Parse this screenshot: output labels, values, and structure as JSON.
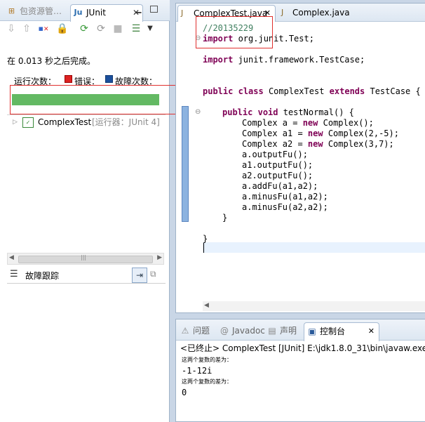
{
  "left_panel": {
    "tabs": [
      {
        "label": "包资源管…",
        "icon": "package-explorer-icon"
      },
      {
        "label": "JUnit",
        "icon": "junit-icon"
      }
    ],
    "status_text": "在 0.013 秒之后完成。",
    "runs_label": "运行次数：",
    "errors_label": "错误：",
    "failures_label": "故障次数：",
    "progress": 1.0,
    "progress_color": "#63b963",
    "tree_item": "ComplexTest",
    "tree_runner": "[运行器：JUnit 4]",
    "failure_trace_label": "故障跟踪",
    "scroll_left": "◀",
    "scroll_mid": "|||",
    "scroll_right": "▶"
  },
  "editor": {
    "tabs": [
      {
        "label": "ComplexTest.java",
        "icon": "java-file-icon"
      },
      {
        "label": "Complex.java",
        "icon": "java-file-icon"
      }
    ],
    "code": {
      "comment": "//20135229",
      "import_kw": "import",
      "import1_rest": " org.junit.Test;",
      "import2_rest": " junit.framework.TestCase;",
      "class_public": "public",
      "class_class": "class",
      "class_name": "ComplexTest",
      "class_extends": "extends",
      "class_tail": "TestCase {",
      "method_public": "public",
      "method_void": "void",
      "method_tail": "testNormal() {",
      "a_head": "Complex a = ",
      "new_kw": "new",
      "a_tail": " Complex();",
      "a1_head": "Complex a1 = ",
      "a1_tail": " Complex(2,-5);",
      "a2_head": "Complex a2 = ",
      "a2_tail": " Complex(3,7);",
      "l1": "a.outputFu();",
      "l2": "a1.outputFu();",
      "l3": "a2.outputFu();",
      "l4": "a.addFu(a1,a2);",
      "l5": "a.minusFu(a1,a2);",
      "l6": "a.minusFu(a2,a2);",
      "close_method": "}",
      "close_class": "}"
    }
  },
  "console": {
    "tabs": [
      {
        "label": "问题",
        "icon": "problems-icon"
      },
      {
        "label": "Javadoc",
        "icon": "at-icon"
      },
      {
        "label": "声明",
        "icon": "declaration-icon"
      },
      {
        "label": "控制台",
        "icon": "console-icon"
      }
    ],
    "header": "<已终止> ComplexTest [JUnit] E:\\jdk1.8.0_31\\bin\\javaw.exe (",
    "out1_label": "这两个复数的差为：",
    "out1_value": "-1-12i",
    "out2_label": "这两个复数的差为：",
    "out2_value": "0"
  }
}
